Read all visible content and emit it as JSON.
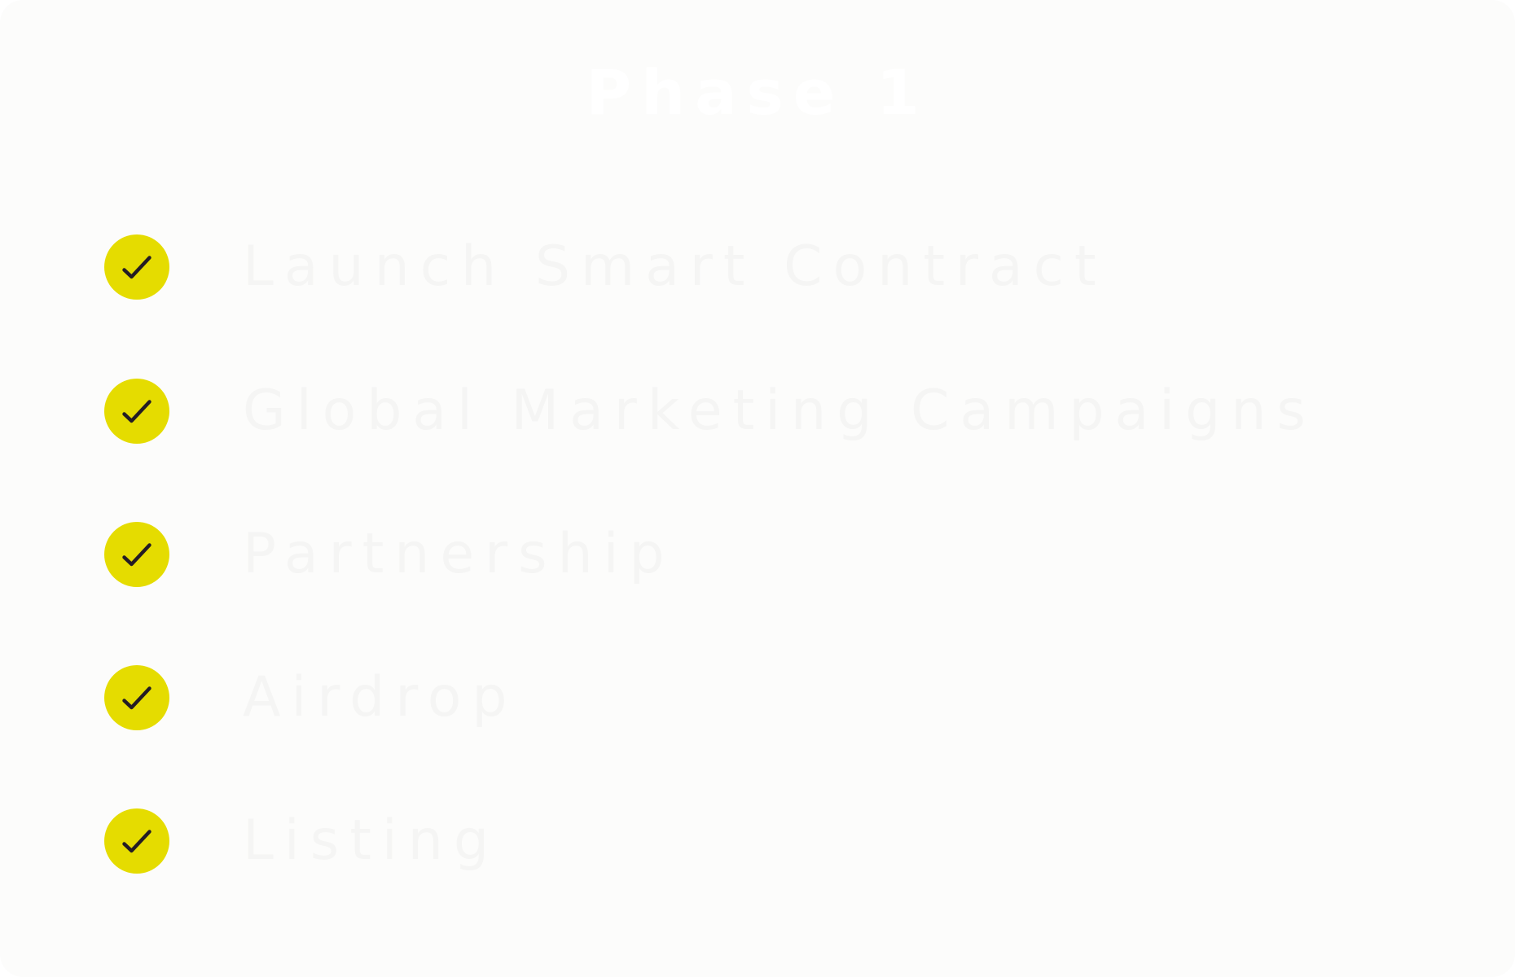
{
  "phase": {
    "title": "Phase 1"
  },
  "checklist": {
    "items": [
      {
        "label": "Launch Smart Contract",
        "status": "done"
      },
      {
        "label": "Global Marketing Campaigns",
        "status": "done"
      },
      {
        "label": "Partnership",
        "status": "done"
      },
      {
        "label": "Airdrop",
        "status": "done"
      },
      {
        "label": "Listing",
        "status": "done"
      }
    ]
  },
  "colors": {
    "card_background": "#fcfcfb",
    "check_circle": "#e5dc00",
    "check_mark": "#231c24",
    "text": "#f5f5f4"
  },
  "icons": {
    "item_status_icon": "check-circle-icon"
  }
}
